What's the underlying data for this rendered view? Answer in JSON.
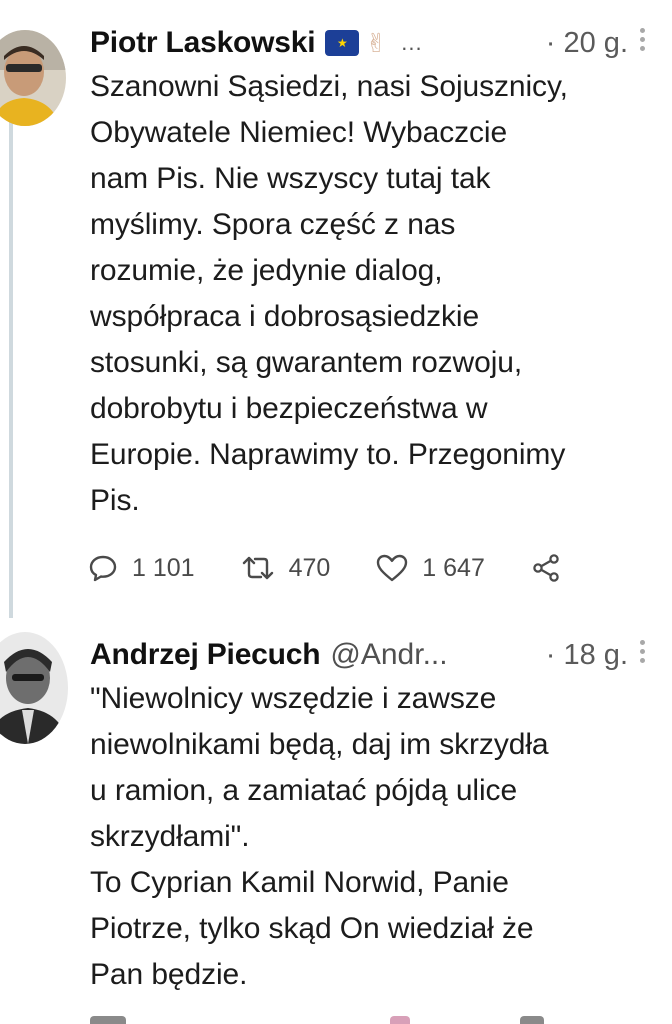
{
  "tweets": [
    {
      "author_name": "Piotr Laskowski",
      "flag_icon": "eu-flag-icon",
      "emoji_icon": "victory-hand-icon",
      "ellipsis": "...",
      "time": "· 20 g.",
      "text": "Szanowni Sąsiedzi, nasi Sojusznicy,\nObywatele Niemiec! Wybaczcie\nnam Pis. Nie wszyscy tutaj tak\nmyślimy. Spora część z nas\nrozumie, że jedynie dialog,\nwspółpraca i dobrosąsiedzkie\nstosunki, są gwarantem rozwoju,\ndobrobytu i bezpieczeństwa w\nEuropie. Naprawimy to. Przegonimy\nPis.",
      "actions": {
        "replies": "1 101",
        "retweets": "470",
        "likes": "1 647"
      }
    },
    {
      "author_name": "Andrzej Piecuch",
      "handle": "@Andr...",
      "time": "· 18 g.",
      "text": "\"Niewolnicy wszędzie i zawsze\nniewolnikami będą, daj im skrzydła\nu ramion, a zamiatać pójdą ulice\nskrzydłami\".\nTo Cyprian Kamil Norwid, Panie\nPiotrze, tylko skąd On wiedział że\nPan będzie."
    }
  ],
  "colors": {
    "text": "#1c1c1c",
    "muted": "#505050",
    "thread_line": "#cfd9de",
    "eu_blue": "#1c3f97",
    "eu_star": "#ffd500"
  }
}
